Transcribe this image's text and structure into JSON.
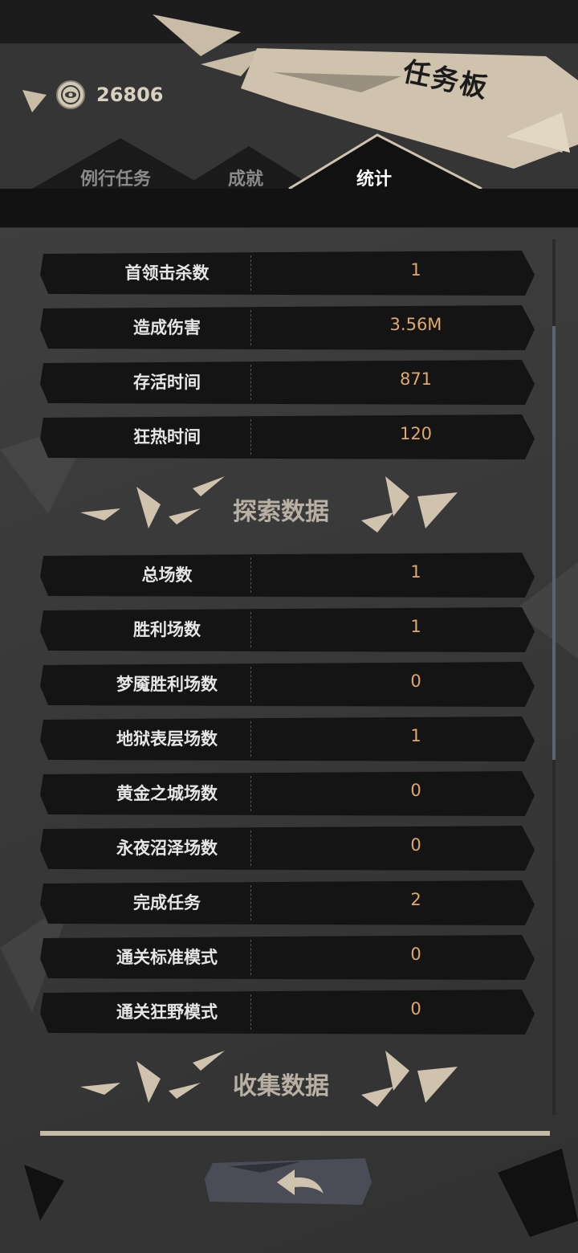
{
  "header": {
    "title": "任务板",
    "currency": {
      "icon": "coin-icon",
      "value": "26806"
    }
  },
  "tabs": [
    {
      "label": "例行任务",
      "active": false
    },
    {
      "label": "成就",
      "active": false
    },
    {
      "label": "统计",
      "active": true
    }
  ],
  "stats_top": [
    {
      "label": "首领击杀数",
      "value": "1"
    },
    {
      "label": "造成伤害",
      "value": "3.56M"
    },
    {
      "label": "存活时间",
      "value": "871"
    },
    {
      "label": "狂热时间",
      "value": "120"
    }
  ],
  "section_explore": {
    "title": "探索数据"
  },
  "stats_explore": [
    {
      "label": "总场数",
      "value": "1"
    },
    {
      "label": "胜利场数",
      "value": "1"
    },
    {
      "label": "梦魇胜利场数",
      "value": "0"
    },
    {
      "label": "地狱表层场数",
      "value": "1"
    },
    {
      "label": "黄金之城场数",
      "value": "0"
    },
    {
      "label": "永夜沼泽场数",
      "value": "0"
    },
    {
      "label": "完成任务",
      "value": "2"
    },
    {
      "label": "通关标准模式",
      "value": "0"
    },
    {
      "label": "通关狂野模式",
      "value": "0"
    }
  ],
  "section_collect": {
    "title": "收集数据"
  },
  "footer": {
    "back_icon": "back-arrow-icon"
  },
  "colors": {
    "accent_value": "#e1a86a",
    "row_bg": "#141414",
    "paper": "#cfc3ad"
  }
}
